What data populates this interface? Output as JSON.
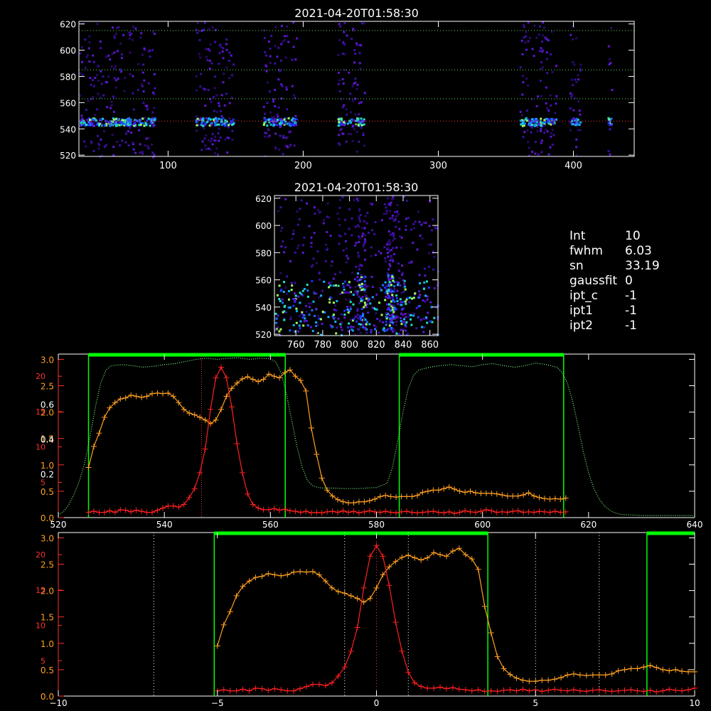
{
  "titles": {
    "top": "2021-04-20T01:58:30",
    "middle": "2021-04-20T01:58:30"
  },
  "info_panel": [
    {
      "key": "Int",
      "value": "10"
    },
    {
      "key": "fwhm",
      "value": "6.03"
    },
    {
      "key": "sn",
      "value": "33.19"
    },
    {
      "key": "gaussfit",
      "value": "0"
    },
    {
      "key": "ipt_c",
      "value": "-1"
    },
    {
      "key": "ipt1",
      "value": "-1"
    },
    {
      "key": "ipt2",
      "value": "-1"
    }
  ],
  "colors": {
    "profile": "#ff2020",
    "ratio": "#ffa020",
    "filter": "#7fff7f",
    "window": "#00ff00",
    "axis_left": "#ff3030",
    "axis_right": "#ffffff"
  },
  "chart_data": [
    {
      "type": "heatmap",
      "title": "2021-04-20T01:58:30",
      "xlim": [
        34,
        445
      ],
      "ylim": [
        519,
        622
      ],
      "xticks": [
        "100",
        "200",
        "300",
        "400"
      ],
      "yticks": [
        "520",
        "540",
        "560",
        "580",
        "600",
        "620"
      ],
      "bright_bands_x": [
        [
          34,
          90
        ],
        [
          120,
          148
        ],
        [
          170,
          195
        ],
        [
          225,
          245
        ],
        [
          360,
          387
        ],
        [
          397,
          405
        ],
        [
          425,
          428
        ]
      ],
      "dotted_y": [
        546,
        563,
        585,
        615
      ]
    },
    {
      "type": "heatmap",
      "title": "2021-04-20T01:58:30",
      "xlim": [
        744,
        866
      ],
      "ylim": [
        519,
        622
      ],
      "xticks": [
        "760",
        "780",
        "800",
        "820",
        "840",
        "860"
      ],
      "yticks": [
        "520",
        "540",
        "560",
        "580",
        "600",
        "620"
      ]
    },
    {
      "type": "line",
      "xlim": [
        520,
        640
      ],
      "x_ticks": [
        "520",
        "540",
        "560",
        "580",
        "600",
        "620",
        "640"
      ],
      "y_left_ticks": [
        "0.0",
        "0.5",
        "1.0",
        "1.5",
        "2.0",
        "2.5",
        "3.0"
      ],
      "y_left2_ticks": [
        "0.2",
        "0.4",
        "0.6"
      ],
      "y_left_red_ticks": [
        "5",
        "10",
        "15",
        "20"
      ],
      "green_windows": [
        [
          525.7,
          562.8
        ],
        [
          584.3,
          615.3
        ]
      ],
      "center_line_x": 547,
      "series": [
        {
          "x": [
            525.7,
            526.7,
            527.7,
            528.7,
            529.7,
            530.7,
            531.7,
            532.7,
            533.7,
            534.7,
            535.7,
            536.7,
            537.7,
            538.7,
            539.7,
            540.7,
            541.7,
            542.7,
            543.7,
            544.7,
            545.7,
            546.7,
            547.7,
            548.7,
            549.7,
            550.7,
            551.7,
            552.7,
            553.7,
            554.7,
            555.7,
            556.7,
            557.7,
            558.7,
            559.7,
            560.7,
            561.7,
            562.7,
            563.7,
            564.7,
            565.7,
            566.7,
            567.7,
            568.7,
            569.7,
            570.7,
            571.7,
            572.7,
            573.7,
            574.7,
            575.7,
            576.7,
            577.7,
            578.7,
            579.7,
            580.7,
            581.7,
            582.7,
            583.7,
            584.7,
            585.7,
            586.7,
            587.7,
            588.7,
            589.7,
            590.7,
            591.7,
            592.7,
            593.7,
            594.7,
            595.7,
            596.7,
            597.7,
            598.7,
            599.7,
            600.7,
            601.7,
            602.7,
            603.7,
            604.7,
            605.7,
            606.7,
            607.7,
            608.7,
            609.7,
            610.7,
            611.7,
            612.7,
            613.7,
            614.7,
            615.7
          ],
          "values": [
            0.95,
            1.35,
            1.6,
            1.9,
            2.08,
            2.18,
            2.25,
            2.27,
            2.32,
            2.3,
            2.28,
            2.3,
            2.35,
            2.36,
            2.35,
            2.36,
            2.3,
            2.18,
            2.05,
            1.98,
            1.95,
            1.9,
            1.85,
            1.78,
            1.85,
            2.05,
            2.3,
            2.45,
            2.55,
            2.63,
            2.67,
            2.62,
            2.58,
            2.62,
            2.72,
            2.68,
            2.65,
            2.75,
            2.8,
            2.68,
            2.6,
            2.4,
            1.7,
            1.2,
            0.75,
            0.52,
            0.41,
            0.34,
            0.3,
            0.28,
            0.28,
            0.3,
            0.3,
            0.32,
            0.35,
            0.4,
            0.42,
            0.4,
            0.39,
            0.4,
            0.4,
            0.4,
            0.42,
            0.48,
            0.5,
            0.52,
            0.52,
            0.55,
            0.58,
            0.54,
            0.5,
            0.48,
            0.5,
            0.47,
            0.46,
            0.46,
            0.46,
            0.45,
            0.43,
            0.41,
            0.41,
            0.41,
            0.43,
            0.47,
            0.41,
            0.38,
            0.36,
            0.35,
            0.36,
            0.35,
            0.37
          ]
        },
        {
          "x": [
            525.7,
            526.7,
            527.7,
            528.7,
            529.7,
            530.7,
            531.7,
            532.7,
            533.7,
            534.7,
            535.7,
            536.7,
            537.7,
            538.7,
            539.7,
            540.7,
            541.7,
            542.7,
            543.7,
            544.7,
            545.7,
            546.7,
            547.7,
            548.7,
            549.7,
            550.7,
            551.7,
            552.7,
            553.7,
            554.7,
            555.7,
            556.7,
            557.7,
            558.7,
            559.7,
            560.7,
            561.7,
            562.7,
            563.7,
            564.7,
            565.7,
            566.7,
            567.7,
            568.7,
            569.7,
            570.7,
            571.7,
            572.7,
            573.7,
            574.7,
            575.7,
            576.7,
            577.7,
            578.7,
            579.7,
            580.7,
            581.7,
            582.7,
            583.7,
            584.7,
            585.7,
            586.7,
            587.7,
            588.7,
            589.7,
            590.7,
            591.7,
            592.7,
            593.7,
            594.7,
            595.7,
            596.7,
            597.7,
            598.7,
            599.7,
            600.7,
            601.7,
            602.7,
            603.7,
            604.7,
            605.7,
            606.7,
            607.7,
            608.7,
            609.7,
            610.7,
            611.7,
            612.7,
            613.7,
            614.7,
            615.7
          ],
          "values": [
            0.1,
            0.12,
            0.1,
            0.1,
            0.13,
            0.1,
            0.15,
            0.14,
            0.11,
            0.14,
            0.12,
            0.1,
            0.1,
            0.14,
            0.18,
            0.22,
            0.22,
            0.2,
            0.25,
            0.38,
            0.55,
            0.85,
            1.3,
            2.05,
            2.65,
            2.85,
            2.65,
            2.1,
            1.4,
            0.85,
            0.45,
            0.25,
            0.18,
            0.15,
            0.15,
            0.17,
            0.14,
            0.16,
            0.13,
            0.12,
            0.1,
            0.12,
            0.09,
            0.1,
            0.09,
            0.11,
            0.12,
            0.1,
            0.13,
            0.1,
            0.12,
            0.09,
            0.11,
            0.13,
            0.11,
            0.1,
            0.12,
            0.1,
            0.09,
            0.11,
            0.12,
            0.1,
            0.09,
            0.1,
            0.11,
            0.12,
            0.1,
            0.09,
            0.11,
            0.08,
            0.1,
            0.13,
            0.11,
            0.1,
            0.12,
            0.15,
            0.13,
            0.1,
            0.11,
            0.1,
            0.12,
            0.13,
            0.1,
            0.11,
            0.1,
            0.12,
            0.11,
            0.1,
            0.12,
            0.1,
            0.11
          ]
        },
        {
          "x": [
            520,
            521,
            522,
            523,
            524,
            525,
            526,
            527,
            528,
            529,
            530,
            532,
            534,
            536,
            538,
            540,
            542,
            544,
            546,
            548,
            550,
            552,
            554,
            556,
            558,
            560,
            561,
            562,
            563,
            564,
            565,
            566,
            567,
            568,
            569,
            570,
            572,
            574,
            576,
            578,
            580,
            582,
            583,
            584,
            585,
            586,
            587,
            588,
            590,
            592,
            594,
            596,
            598,
            600,
            602,
            604,
            606,
            608,
            610,
            612,
            614,
            615,
            616,
            617,
            618,
            619,
            620,
            621,
            622,
            623,
            624,
            625,
            626,
            628,
            630,
            632,
            634,
            636,
            638,
            640
          ],
          "values": [
            0.05,
            0.12,
            0.25,
            0.45,
            0.7,
            1.05,
            1.55,
            2.1,
            2.55,
            2.8,
            2.88,
            2.9,
            2.88,
            2.85,
            2.87,
            2.9,
            2.92,
            2.96,
            3.0,
            3.02,
            3.0,
            3.02,
            3.03,
            3.0,
            3.02,
            3.01,
            2.95,
            2.75,
            2.35,
            1.85,
            1.35,
            0.95,
            0.7,
            0.6,
            0.57,
            0.56,
            0.56,
            0.55,
            0.55,
            0.56,
            0.57,
            0.65,
            0.95,
            1.45,
            2.0,
            2.45,
            2.7,
            2.8,
            2.85,
            2.88,
            2.9,
            2.88,
            2.86,
            2.9,
            2.92,
            2.88,
            2.85,
            2.88,
            2.93,
            2.9,
            2.85,
            2.75,
            2.55,
            2.2,
            1.75,
            1.25,
            0.85,
            0.55,
            0.35,
            0.22,
            0.14,
            0.09,
            0.06,
            0.05,
            0.04,
            0.04,
            0.04,
            0.04,
            0.04,
            0.04
          ]
        }
      ]
    },
    {
      "type": "line",
      "xlim": [
        -10,
        10
      ],
      "x_ticks": [
        "−10",
        "−5",
        "0",
        "5",
        "10"
      ],
      "y_left_ticks": [
        "0.0",
        "0.5",
        "1.0",
        "1.5",
        "2.0",
        "2.5",
        "3.0"
      ],
      "y_left_red_ticks": [
        "5",
        "10",
        "15",
        "20"
      ],
      "green_windows": [
        [
          -5.1,
          3.5
        ],
        [
          8.5,
          10
        ]
      ],
      "dotted_x": [
        -7,
        -1,
        1,
        5,
        7,
        0
      ],
      "series": [
        {
          "x": [
            -5,
            -4.8,
            -4.6,
            -4.4,
            -4.2,
            -4,
            -3.8,
            -3.6,
            -3.4,
            -3.2,
            -3,
            -2.8,
            -2.6,
            -2.4,
            -2.2,
            -2,
            -1.8,
            -1.6,
            -1.4,
            -1.2,
            -1,
            -0.8,
            -0.6,
            -0.4,
            -0.2,
            0,
            0.2,
            0.4,
            0.6,
            0.8,
            1,
            1.2,
            1.4,
            1.6,
            1.8,
            2,
            2.2,
            2.4,
            2.6,
            2.8,
            3,
            3.2,
            3.4,
            3.6,
            3.8,
            4,
            4.2,
            4.4,
            4.6,
            4.8,
            5,
            5.2,
            5.4,
            5.6,
            5.8,
            6,
            6.2,
            6.4,
            6.6,
            6.8,
            7,
            7.2,
            7.4,
            7.6,
            7.8,
            8,
            8.2,
            8.4,
            8.6,
            8.8,
            9,
            9.2,
            9.4,
            9.6,
            9.8,
            10
          ],
          "values": [
            0.95,
            1.35,
            1.6,
            1.9,
            2.08,
            2.18,
            2.25,
            2.27,
            2.32,
            2.3,
            2.28,
            2.3,
            2.35,
            2.36,
            2.35,
            2.36,
            2.3,
            2.18,
            2.05,
            1.98,
            1.95,
            1.9,
            1.85,
            1.78,
            1.85,
            2.05,
            2.3,
            2.45,
            2.55,
            2.63,
            2.67,
            2.62,
            2.58,
            2.62,
            2.72,
            2.68,
            2.65,
            2.75,
            2.8,
            2.68,
            2.6,
            2.4,
            1.7,
            1.2,
            0.75,
            0.52,
            0.41,
            0.34,
            0.3,
            0.28,
            0.28,
            0.3,
            0.3,
            0.32,
            0.35,
            0.4,
            0.42,
            0.4,
            0.39,
            0.4,
            0.4,
            0.4,
            0.42,
            0.48,
            0.5,
            0.52,
            0.52,
            0.55,
            0.58,
            0.54,
            0.5,
            0.48,
            0.5,
            0.47,
            0.46,
            0.46
          ]
        },
        {
          "x": [
            -5,
            -4.8,
            -4.6,
            -4.4,
            -4.2,
            -4,
            -3.8,
            -3.6,
            -3.4,
            -3.2,
            -3,
            -2.8,
            -2.6,
            -2.4,
            -2.2,
            -2,
            -1.8,
            -1.6,
            -1.4,
            -1.2,
            -1,
            -0.8,
            -0.6,
            -0.4,
            -0.2,
            0,
            0.2,
            0.4,
            0.6,
            0.8,
            1,
            1.2,
            1.4,
            1.6,
            1.8,
            2,
            2.2,
            2.4,
            2.6,
            2.8,
            3,
            3.2,
            3.4,
            3.6,
            3.8,
            4,
            4.2,
            4.4,
            4.6,
            4.8,
            5,
            5.2,
            5.4,
            5.6,
            5.8,
            6,
            6.2,
            6.4,
            6.6,
            6.8,
            7,
            7.2,
            7.4,
            7.6,
            7.8,
            8,
            8.2,
            8.4,
            8.6,
            8.8,
            9,
            9.2,
            9.4,
            9.6,
            9.8,
            10
          ],
          "values": [
            0.1,
            0.12,
            0.1,
            0.1,
            0.13,
            0.1,
            0.15,
            0.14,
            0.11,
            0.14,
            0.12,
            0.1,
            0.1,
            0.14,
            0.18,
            0.22,
            0.22,
            0.2,
            0.25,
            0.38,
            0.55,
            0.85,
            1.3,
            2.05,
            2.65,
            2.85,
            2.65,
            2.1,
            1.4,
            0.85,
            0.45,
            0.25,
            0.18,
            0.15,
            0.15,
            0.17,
            0.14,
            0.16,
            0.13,
            0.12,
            0.1,
            0.12,
            0.09,
            0.1,
            0.09,
            0.11,
            0.12,
            0.1,
            0.13,
            0.1,
            0.12,
            0.09,
            0.11,
            0.13,
            0.11,
            0.1,
            0.12,
            0.1,
            0.09,
            0.11,
            0.12,
            0.1,
            0.09,
            0.1,
            0.11,
            0.12,
            0.1,
            0.09,
            0.11,
            0.08,
            0.1,
            0.13,
            0.11,
            0.1,
            0.12,
            0.15
          ]
        }
      ]
    }
  ]
}
